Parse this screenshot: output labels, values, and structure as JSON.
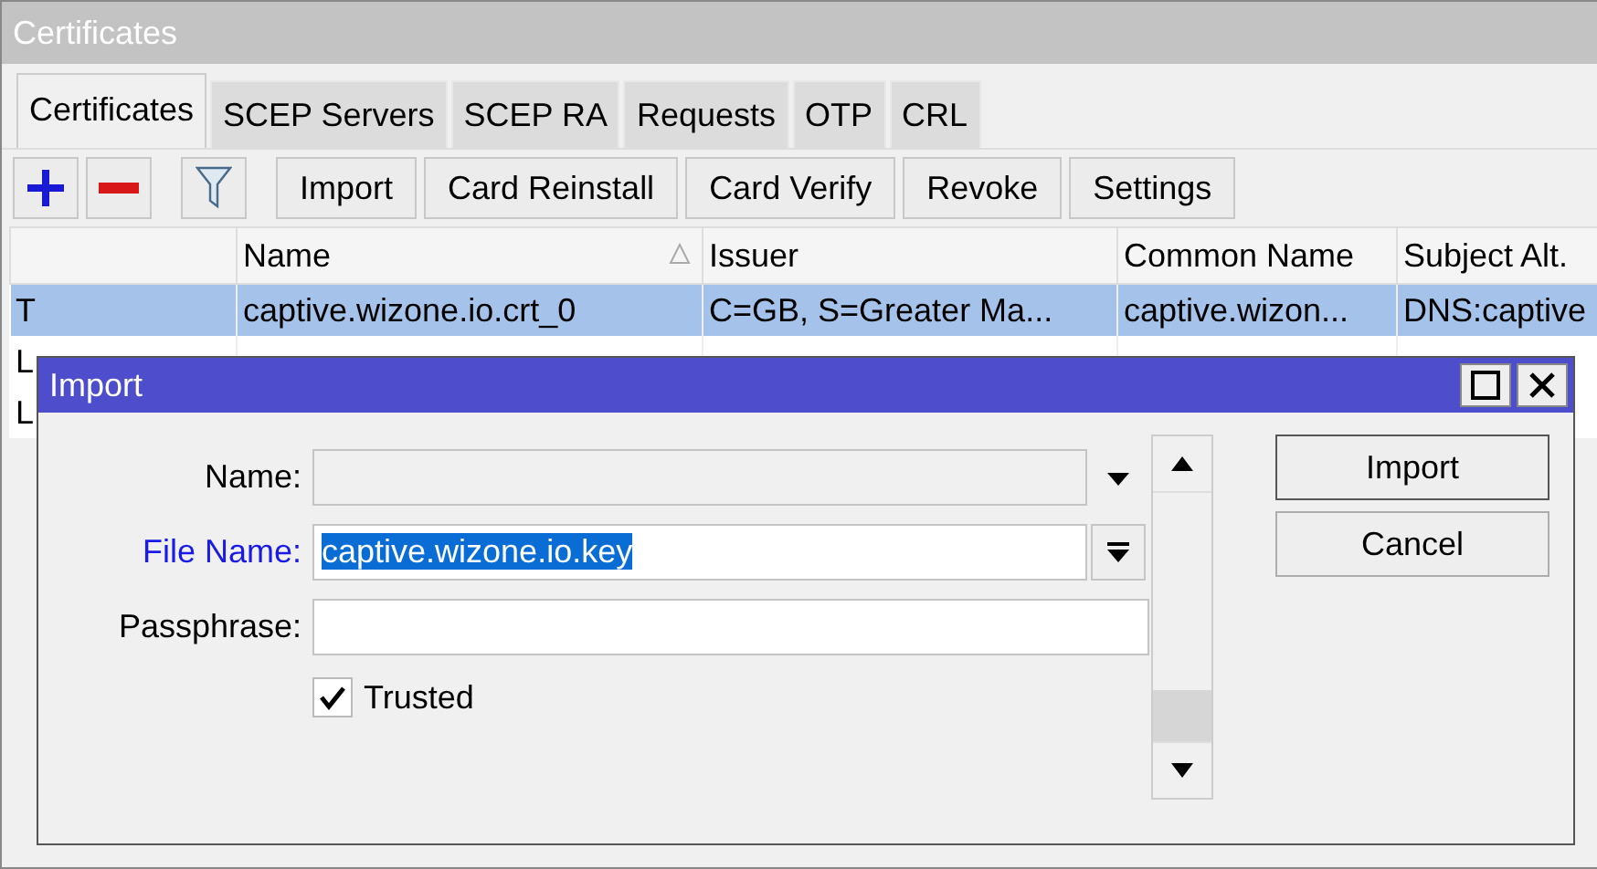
{
  "window": {
    "title": "Certificates"
  },
  "tabs": [
    {
      "label": "Certificates",
      "selected": true
    },
    {
      "label": "SCEP Servers",
      "selected": false
    },
    {
      "label": "SCEP RA",
      "selected": false
    },
    {
      "label": "Requests",
      "selected": false
    },
    {
      "label": "OTP",
      "selected": false
    },
    {
      "label": "CRL",
      "selected": false
    }
  ],
  "toolbar": {
    "buttons": [
      "Import",
      "Card Reinstall",
      "Card Verify",
      "Revoke",
      "Settings"
    ]
  },
  "table": {
    "columns": [
      {
        "sorted": false
      },
      {
        "label": "Name",
        "sorted": true
      },
      {
        "label": "Issuer",
        "sorted": false
      },
      {
        "label": "Common Name",
        "sorted": false
      },
      {
        "label": "Subject Alt.",
        "sorted": false
      }
    ],
    "rows": [
      {
        "cells": [
          "T",
          "captive.wizone.io.crt_0",
          "C=GB, S=Greater Ma...",
          "captive.wizon...",
          "DNS:captive"
        ],
        "selected": true
      },
      {
        "cells": [
          "L"
        ],
        "selected": false
      },
      {
        "cells": [
          "L"
        ],
        "selected": false
      }
    ]
  },
  "dialog": {
    "title": "Import",
    "fields": [
      {
        "kind": "combo",
        "label": "Name:",
        "disabled": true,
        "highlighted": false
      },
      {
        "kind": "file",
        "label": "File Name:",
        "value": "captive.wizone.io.key",
        "disabled": false,
        "highlighted": true
      },
      {
        "kind": "text",
        "label": "Passphrase:",
        "disabled": false,
        "highlighted": false
      }
    ],
    "trusted": {
      "label": "Trusted",
      "checked": true
    },
    "buttons": [
      "Import",
      "Cancel"
    ]
  }
}
